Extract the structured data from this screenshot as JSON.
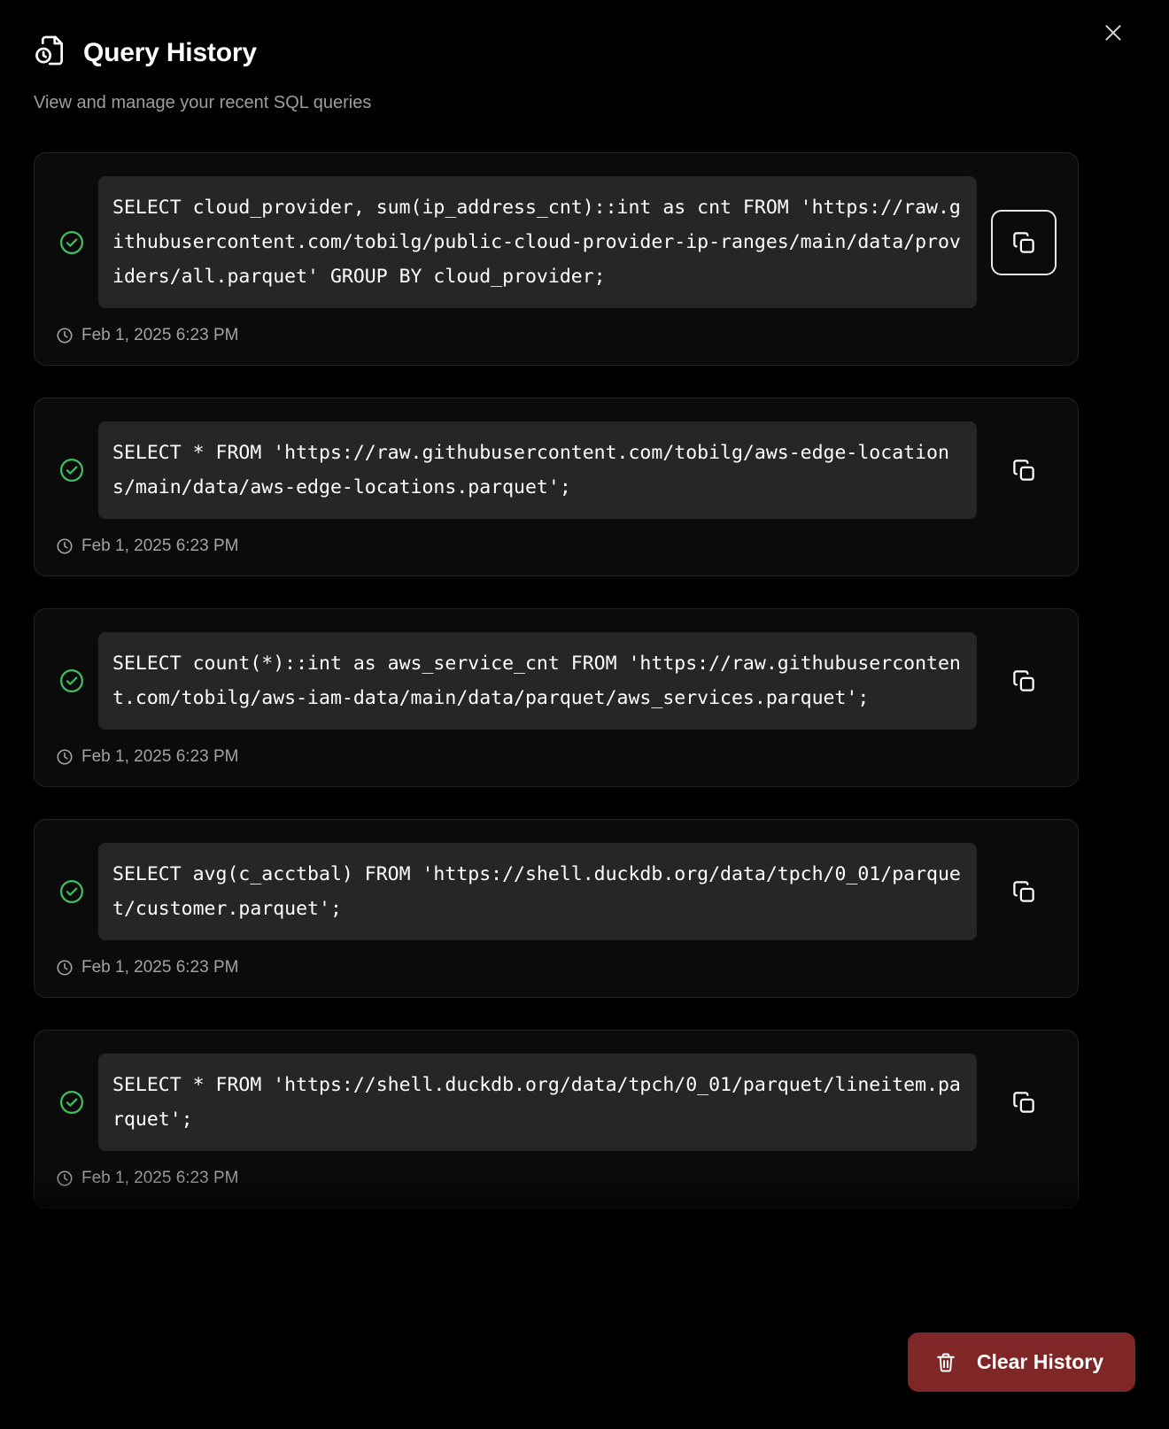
{
  "window": {
    "close_label": "×"
  },
  "header": {
    "title": "Query History",
    "subtitle": "View and manage your recent SQL queries",
    "icon": "file-clock-icon"
  },
  "queries": [
    {
      "status": "success",
      "sql": "SELECT cloud_provider, sum(ip_address_cnt)::int as cnt FROM 'https://raw.githubusercontent.com/tobilg/public-cloud-provider-ip-ranges/main/data/providers/all.parquet' GROUP BY cloud_provider;",
      "timestamp": "Feb 1, 2025 6:23 PM",
      "copy_label": "copy-icon",
      "focused": true
    },
    {
      "status": "success",
      "sql": "SELECT * FROM 'https://raw.githubusercontent.com/tobilg/aws-edge-locations/main/data/aws-edge-locations.parquet';",
      "timestamp": "Feb 1, 2025 6:23 PM",
      "copy_label": "copy-icon",
      "focused": false
    },
    {
      "status": "success",
      "sql": "SELECT count(*)::int as aws_service_cnt FROM 'https://raw.githubusercontent.com/tobilg/aws-iam-data/main/data/parquet/aws_services.parquet';",
      "timestamp": "Feb 1, 2025 6:23 PM",
      "copy_label": "copy-icon",
      "focused": false
    },
    {
      "status": "success",
      "sql": "SELECT avg(c_acctbal) FROM 'https://shell.duckdb.org/data/tpch/0_01/parquet/customer.parquet';",
      "timestamp": "Feb 1, 2025 6:23 PM",
      "copy_label": "copy-icon",
      "focused": false
    },
    {
      "status": "success",
      "sql": "SELECT * FROM 'https://shell.duckdb.org/data/tpch/0_01/parquet/lineitem.parquet';",
      "timestamp": "Feb 1, 2025 6:23 PM",
      "copy_label": "copy-icon",
      "focused": false
    }
  ],
  "footer": {
    "clear_label": "Clear History",
    "clear_icon": "trash-icon"
  },
  "colors": {
    "background": "#000000",
    "card_background": "#0b0b0b",
    "card_border": "#232323",
    "code_background": "#262626",
    "success": "#3fbf5f",
    "danger": "#7f2727",
    "text_primary": "#ffffff",
    "text_muted": "#9e9e9e"
  }
}
